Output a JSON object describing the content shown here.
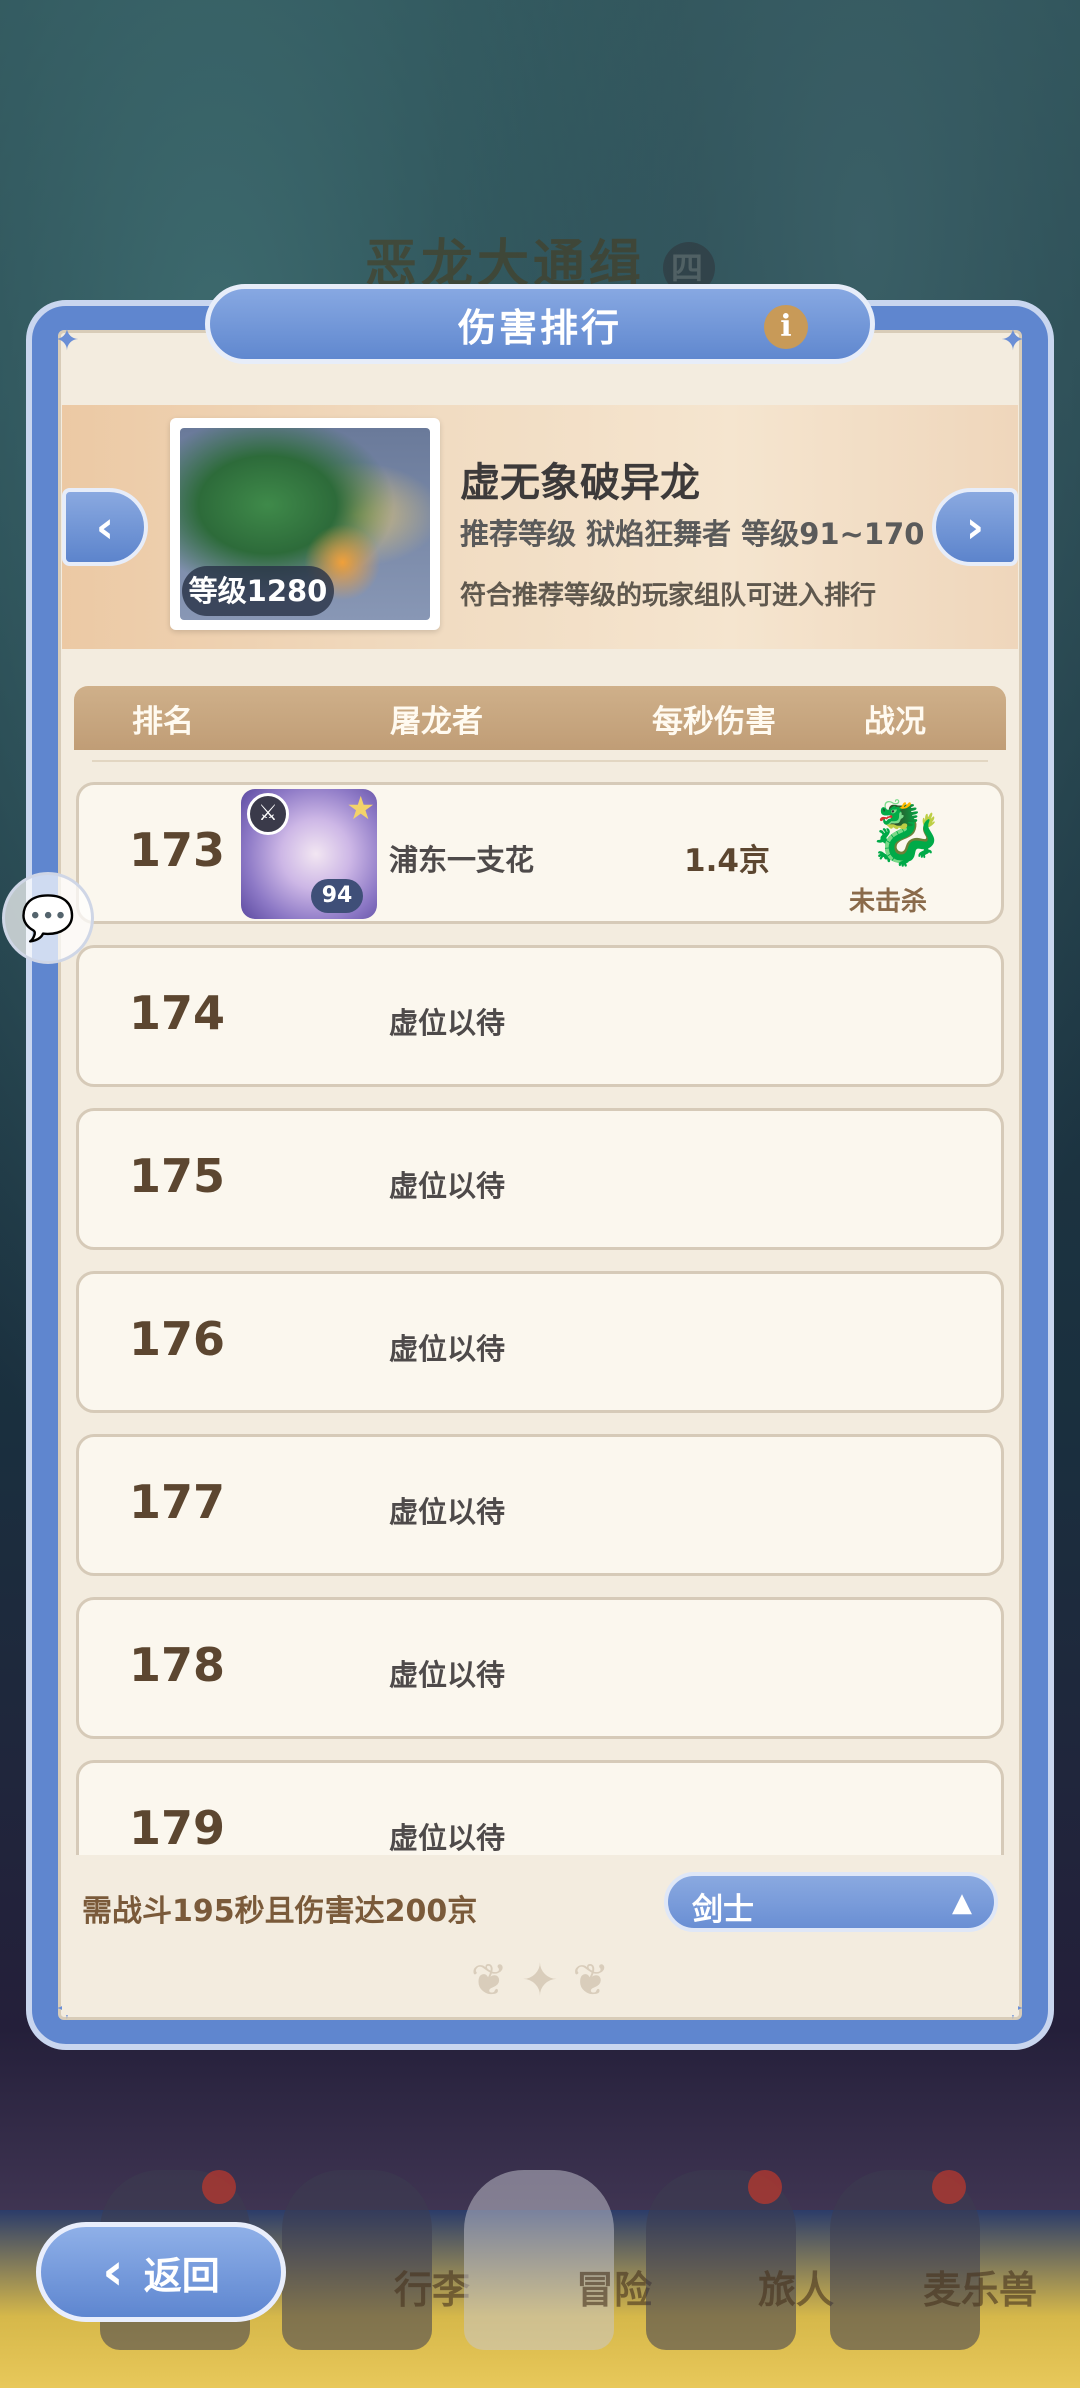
{
  "background": {
    "title": "恶龙大通缉",
    "title_tag": "四"
  },
  "panel": {
    "title": "伤害排行",
    "info_icon": "info-icon"
  },
  "boss": {
    "level_label": "等级1280",
    "name": "虚无象破异龙",
    "recommendation": "推荐等级 狱焰狂舞者  等级91~170",
    "note": "符合推荐等级的玩家组队可进入排行"
  },
  "table": {
    "headers": [
      "排名",
      "屠龙者",
      "每秒伤害",
      "战况"
    ],
    "rows": [
      {
        "rank": "173",
        "name": "浦东一支花",
        "dps": "1.4京",
        "status": "未击杀",
        "avatar_level": "94"
      },
      {
        "rank": "174",
        "name": "虚位以待"
      },
      {
        "rank": "175",
        "name": "虚位以待"
      },
      {
        "rank": "176",
        "name": "虚位以待"
      },
      {
        "rank": "177",
        "name": "虚位以待"
      },
      {
        "rank": "178",
        "name": "虚位以待"
      },
      {
        "rank": "179",
        "name": "虚位以待"
      }
    ]
  },
  "footer": {
    "requirement": "需战斗195秒且伤害达200京",
    "class_select": "剑士"
  },
  "nav": {
    "back_label": "返回",
    "items": [
      "行李",
      "冒险",
      "旅人",
      "麦乐兽"
    ]
  },
  "colors": {
    "panel_blue": "#5f86cf",
    "panel_cream": "#f3ecdf",
    "header_tan": "#c09d76",
    "rank_brown": "#5c4630"
  }
}
